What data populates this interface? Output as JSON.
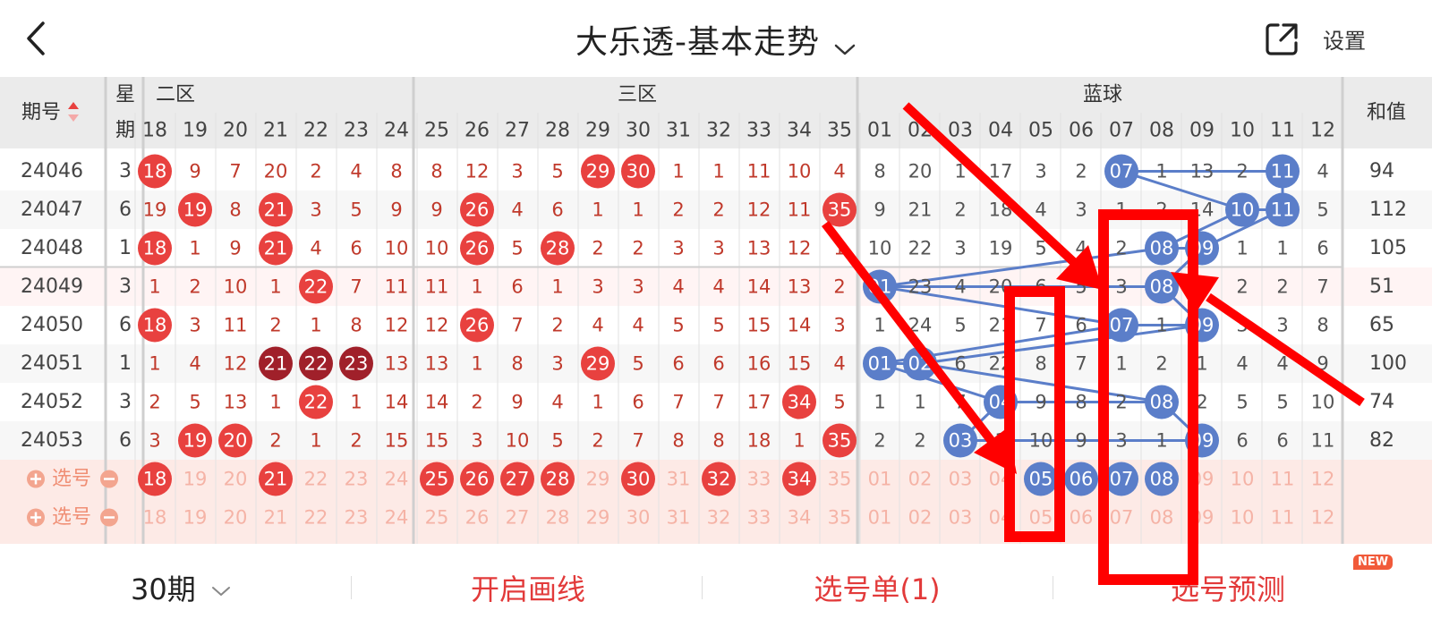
{
  "header": {
    "title": "大乐透-基本走势",
    "settings_label": "设置"
  },
  "table": {
    "period_header": "期号",
    "weekday_header": [
      "星",
      "期"
    ],
    "zone_labels": [
      "二区",
      "三区",
      "蓝球"
    ],
    "sum_header": "和值",
    "red_columns": [
      "18",
      "19",
      "20",
      "21",
      "22",
      "23",
      "24",
      "25",
      "26",
      "27",
      "28",
      "29",
      "30",
      "31",
      "32",
      "33",
      "34",
      "35"
    ],
    "blue_columns": [
      "01",
      "02",
      "03",
      "04",
      "05",
      "06",
      "07",
      "08",
      "09",
      "10",
      "11",
      "12"
    ],
    "rows": [
      {
        "period": "24046",
        "weekday": "3",
        "red": [
          "18",
          "9",
          "7",
          "20",
          "2",
          "4",
          "8",
          "8",
          "12",
          "3",
          "5",
          "29",
          "30",
          "1",
          "1",
          "11",
          "10",
          "4"
        ],
        "blue": [
          "8",
          "20",
          "1",
          "17",
          "3",
          "2",
          "07",
          "1",
          "13",
          "2",
          "11",
          "4"
        ],
        "sum": "94"
      },
      {
        "period": "24047",
        "weekday": "6",
        "red": [
          "19",
          "19",
          "8",
          "21",
          "3",
          "5",
          "9",
          "9",
          "26",
          "4",
          "6",
          "1",
          "1",
          "2",
          "2",
          "12",
          "11",
          "35"
        ],
        "blue": [
          "9",
          "21",
          "2",
          "18",
          "4",
          "3",
          "1",
          "2",
          "14",
          "10",
          "11",
          "5"
        ],
        "sum": "112"
      },
      {
        "period": "24048",
        "weekday": "1",
        "red": [
          "18",
          "1",
          "9",
          "21",
          "4",
          "6",
          "10",
          "10",
          "26",
          "5",
          "28",
          "2",
          "2",
          "3",
          "3",
          "13",
          "12",
          "1"
        ],
        "blue": [
          "10",
          "22",
          "3",
          "19",
          "5",
          "4",
          "2",
          "08",
          "09",
          "1",
          "1",
          "6"
        ],
        "sum": "105"
      },
      {
        "period": "24049",
        "weekday": "3",
        "red": [
          "1",
          "2",
          "10",
          "1",
          "22",
          "7",
          "11",
          "11",
          "1",
          "6",
          "1",
          "3",
          "3",
          "4",
          "4",
          "14",
          "13",
          "2"
        ],
        "blue": [
          "01",
          "23",
          "4",
          "20",
          "6",
          "5",
          "3",
          "08",
          "1",
          "2",
          "2",
          "7"
        ],
        "sum": "51"
      },
      {
        "period": "24050",
        "weekday": "6",
        "red": [
          "18",
          "3",
          "11",
          "2",
          "1",
          "8",
          "12",
          "12",
          "26",
          "7",
          "2",
          "4",
          "4",
          "5",
          "5",
          "15",
          "14",
          "3"
        ],
        "blue": [
          "1",
          "24",
          "5",
          "21",
          "7",
          "6",
          "07",
          "1",
          "09",
          "3",
          "3",
          "8"
        ],
        "sum": "65"
      },
      {
        "period": "24051",
        "weekday": "1",
        "red": [
          "1",
          "4",
          "12",
          "21",
          "22",
          "23",
          "13",
          "13",
          "1",
          "8",
          "3",
          "29",
          "5",
          "6",
          "6",
          "16",
          "15",
          "4"
        ],
        "blue": [
          "01",
          "02",
          "6",
          "22",
          "8",
          "7",
          "1",
          "2",
          "1",
          "4",
          "4",
          "9"
        ],
        "sum": "100"
      },
      {
        "period": "24052",
        "weekday": "3",
        "red": [
          "2",
          "5",
          "13",
          "1",
          "22",
          "1",
          "14",
          "14",
          "2",
          "9",
          "4",
          "1",
          "6",
          "7",
          "7",
          "17",
          "34",
          "5"
        ],
        "blue": [
          "1",
          "1",
          "7",
          "04",
          "9",
          "8",
          "2",
          "08",
          "2",
          "5",
          "5",
          "10"
        ],
        "sum": "74"
      },
      {
        "period": "24053",
        "weekday": "6",
        "red": [
          "3",
          "19",
          "20",
          "2",
          "1",
          "2",
          "15",
          "15",
          "3",
          "10",
          "5",
          "2",
          "7",
          "8",
          "8",
          "18",
          "1",
          "35"
        ],
        "blue": [
          "2",
          "2",
          "03",
          "1",
          "10",
          "9",
          "3",
          "1",
          "09",
          "6",
          "6",
          "11"
        ],
        "sum": "82"
      }
    ],
    "hits": {
      "red": [
        [],
        [
          "19"
        ],
        [
          "21"
        ],
        [
          "21",
          "28"
        ],
        [
          "22"
        ],
        [
          "18",
          "26"
        ],
        [
          "21",
          "22",
          "23",
          "29"
        ],
        [
          "22",
          "34"
        ],
        [
          "19",
          "20",
          "35"
        ]
      ],
      "red_row_hits": [
        [
          "18",
          "29",
          "30"
        ],
        [
          "19",
          "21",
          "26",
          "35"
        ],
        [
          "18",
          "21",
          "26",
          "28"
        ],
        [
          "22"
        ],
        [
          "18",
          "26"
        ],
        [
          "21",
          "22",
          "23",
          "29"
        ],
        [
          "22",
          "34"
        ],
        [
          "19",
          "20",
          "35"
        ]
      ],
      "dark_red_row": 5,
      "blue_row_hits": [
        [
          "07",
          "11"
        ],
        [
          "10",
          "11"
        ],
        [
          "08",
          "09"
        ],
        [
          "01",
          "08"
        ],
        [
          "07",
          "09"
        ],
        [
          "01",
          "02"
        ],
        [
          "04",
          "08"
        ],
        [
          "03",
          "09"
        ]
      ]
    },
    "select_rows": [
      {
        "label": "选号",
        "red_selected": [
          "18",
          "21",
          "25",
          "26",
          "27",
          "28",
          "30",
          "32",
          "34"
        ],
        "blue_selected": [
          "05",
          "06",
          "07",
          "08"
        ]
      },
      {
        "label": "选号",
        "red_selected": [],
        "blue_selected": []
      }
    ]
  },
  "bottom": {
    "periods_label": "30期",
    "draw_lines_label": "开启画线",
    "selection_list_label": "选号单(1)",
    "predict_label": "选号预测",
    "new_badge": "NEW"
  },
  "colors": {
    "red_ball": "#e8413f",
    "dark_red_ball": "#a0202a",
    "blue_ball": "#5b7ec9",
    "red_text": "#c0392b",
    "select_bg": "#fdeae6",
    "annotation": "#ff0000"
  }
}
